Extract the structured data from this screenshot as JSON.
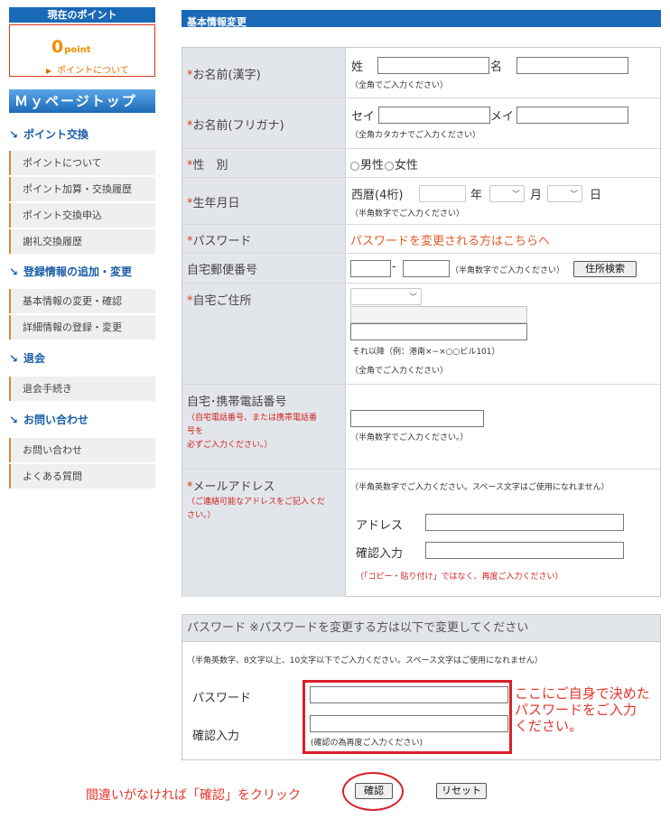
{
  "sidebar": {
    "points_heading": "現在のポイント",
    "points_value": "0",
    "points_unit": "point",
    "points_link": "ポイントについて",
    "mypage_top": "Ｍｙページトップ",
    "sections": [
      {
        "title": "ポイント交換",
        "items": [
          "ポイントについて",
          "ポイント加算・交換履歴",
          "ポイント交換申込",
          "謝礼交換履歴"
        ]
      },
      {
        "title": "登録情報の追加・変更",
        "items": [
          "基本情報の変更・確認",
          "詳細情報の登録・変更"
        ]
      },
      {
        "title": "退会",
        "items": [
          "退会手続き"
        ]
      },
      {
        "title": "お問い合わせ",
        "items": [
          "お問い合わせ",
          "よくある質問"
        ]
      }
    ]
  },
  "main": {
    "heading": "基本情報変更",
    "req_mark": "*",
    "name_kanji": {
      "label": "お名前(漢字)",
      "sei": "姓",
      "mei": "名",
      "note": "（全角でご入力ください）"
    },
    "name_kana": {
      "label": "お名前(フリガナ)",
      "sei": "セイ",
      "mei": "メイ",
      "note": "（全角カタカナでご入力ください）"
    },
    "gender": {
      "label": "性　別",
      "male": "男性",
      "female": "女性"
    },
    "birthday": {
      "label": "生年月日",
      "era": "西暦(4桁)",
      "year": "年",
      "month": "月",
      "day": "日",
      "note": "（半角数字でご入力ください）"
    },
    "password": {
      "label": "パスワード",
      "link": "パスワードを変更される方はこちらへ"
    },
    "zip": {
      "label": "自宅郵便番号",
      "dash": "-",
      "note": "（半角数字でご入力ください）",
      "button": "住所検索"
    },
    "address": {
      "label": "自宅ご住所",
      "example": "それ以降（例：港南×−×○○ビル101）",
      "note": "（全角でご入力ください）"
    },
    "phone": {
      "label": "自宅･携帯電話番号",
      "note_red_1": "（自宅電話番号、または携帯電話番",
      "note_red_2": "号を",
      "note_red_3": "必ずご入力ください。）",
      "note": "（半角数字でご入力ください。）"
    },
    "email": {
      "label": "メールアドレス",
      "note_red_1": "（ご連絡可能なアドレスをご記入くだ",
      "note_red_2": "さい。）",
      "note": "（半角英数字でご入力ください。スペース文字はご使用になれません）",
      "address_label": "アドレス",
      "confirm_label": "確認入力",
      "warn": "（「コピー・貼り付け」ではなく、再度ご入力ください）"
    }
  },
  "pw_section": {
    "heading": "パスワード ※パスワードを変更する方は以下で変更してください",
    "note": "（半角英数字、8文字以上、10文字以下でご入力ください。スペース文字はご使用になれません）",
    "pw_label": "パスワード",
    "confirm_label": "確認入力",
    "confirm_note": "(確認の為再度ご入力ください)"
  },
  "annotations": {
    "pw_hint_1": "ここにご自身で決めた",
    "pw_hint_2": "パスワードをご入力",
    "pw_hint_3": "ください。",
    "confirm_hint": "間違いがなければ「確認」をクリック"
  },
  "buttons": {
    "confirm": "確認",
    "reset": "リセット"
  },
  "colors": {
    "brand_blue": "#1a69b7",
    "required_red": "#d23c1c",
    "annotation_red": "#e4362b",
    "point_orange": "#f18d00"
  }
}
